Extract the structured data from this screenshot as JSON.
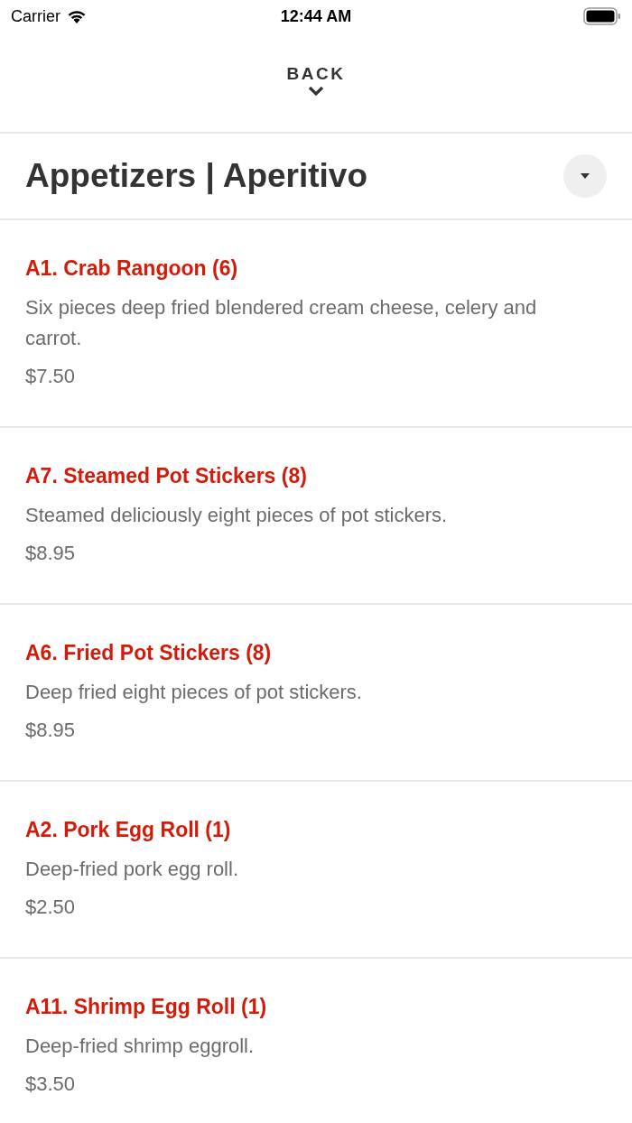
{
  "status_bar": {
    "carrier": "Carrier",
    "time": "12:44 AM"
  },
  "header": {
    "back_label": "BACK"
  },
  "section": {
    "title": "Appetizers | Aperitivo",
    "expanded": true
  },
  "items": [
    {
      "name": "A1. Crab Rangoon (6)",
      "description": "Six pieces deep fried blendered cream cheese, celery and carrot.",
      "price": "$7.50"
    },
    {
      "name": "A7. Steamed Pot Stickers (8)",
      "description": "Steamed deliciously eight pieces of pot stickers.",
      "price": "$8.95"
    },
    {
      "name": "A6. Fried Pot Stickers (8)",
      "description": "Deep fried eight pieces of pot stickers.",
      "price": "$8.95"
    },
    {
      "name": "A2. Pork Egg Roll (1)",
      "description": "Deep-fried pork egg roll.",
      "price": "$2.50"
    },
    {
      "name": "A11. Shrimp Egg Roll (1)",
      "description": "Deep-fried shrimp eggroll.",
      "price": "$3.50"
    }
  ]
}
